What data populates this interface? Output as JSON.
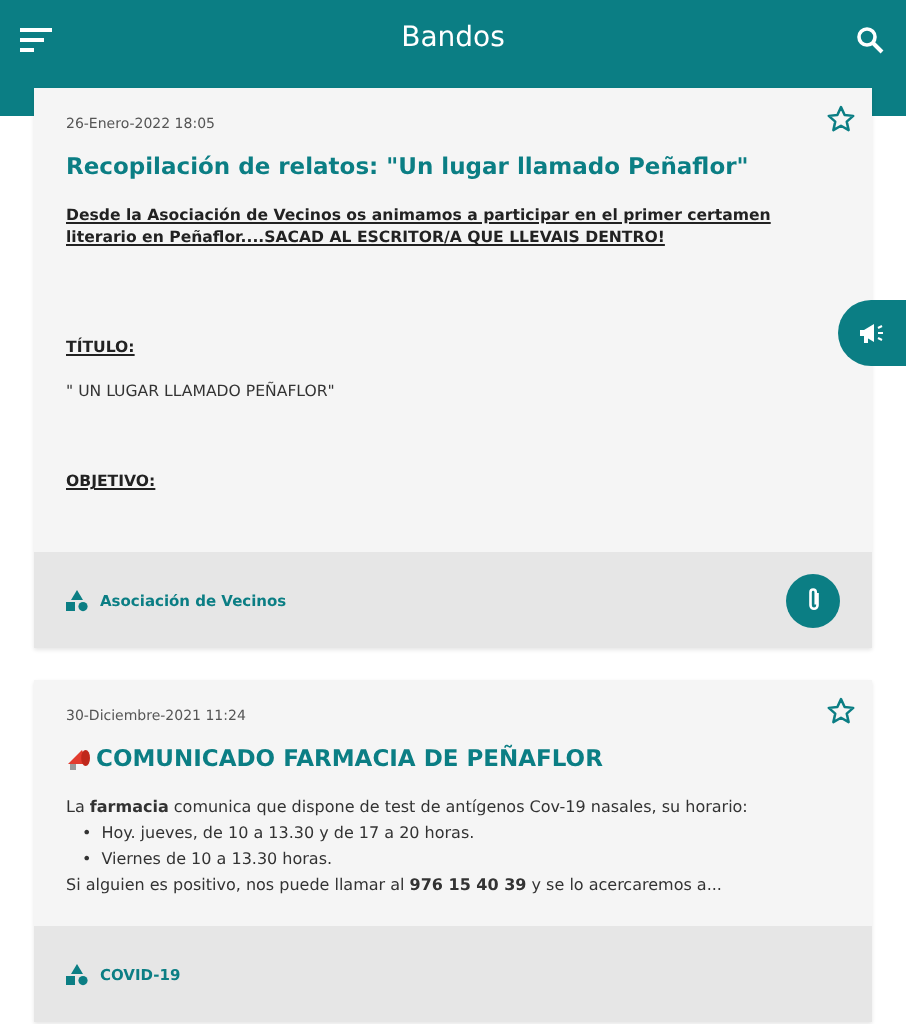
{
  "app_bar": {
    "title": "Bandos"
  },
  "posts": [
    {
      "date": "26-Enero-2022 18:05",
      "title": "Recopilación de relatos: \"Un lugar llamado Peñaflor\"",
      "title_icon": false,
      "favorite": false,
      "has_attachment": true,
      "category": "Asociación de Vecinos",
      "body": [
        {
          "kind": "heading",
          "text": "Desde la Asociación de Vecinos os animamos a participar en el primer certamen literario en Peñaflor....SACAD AL ESCRITOR/A QUE LLEVAIS DENTRO!"
        },
        {
          "kind": "heading",
          "text": "TÍTULO:"
        },
        {
          "kind": "text",
          "text": "\" UN LUGAR LLAMADO PEÑAFLOR\""
        },
        {
          "kind": "heading",
          "text": "OBJETIVO:"
        }
      ]
    },
    {
      "date": "30-Diciembre-2021 11:24",
      "title": "COMUNICADO FARMACIA DE PEÑAFLOR",
      "title_icon": true,
      "favorite": false,
      "has_attachment": false,
      "category": "COVID-19",
      "body": [
        {
          "kind": "paragraph",
          "text": "La **farmacia** comunica que dispone de test de antígenos Cov-19 nasales, su horario:"
        },
        {
          "kind": "bullet",
          "marker": "•",
          "text": "Hoy. jueves, de 10 a 13.30 y de 17 a 20 horas."
        },
        {
          "kind": "bullet",
          "marker": "•",
          "text": "Viernes de 10 a 13.30 horas."
        },
        {
          "kind": "paragraph",
          "text": "Si alguien es positivo, nos puede llamar al **976 15 40 39** y se lo acercaremos a..."
        }
      ]
    }
  ]
}
